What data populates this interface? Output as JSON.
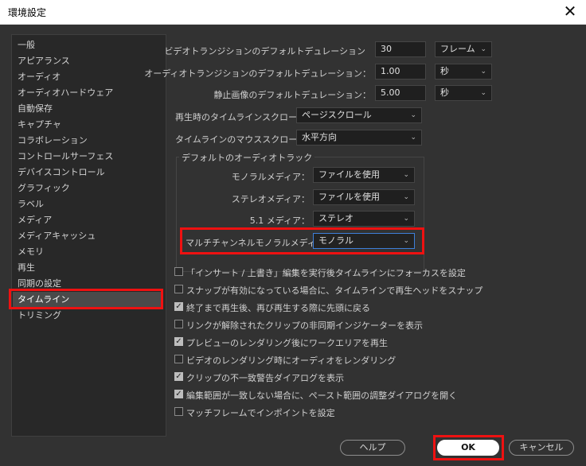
{
  "window": {
    "title": "環境設定",
    "close": "✕"
  },
  "sidebar": {
    "items": [
      {
        "label": "一般"
      },
      {
        "label": "アピアランス"
      },
      {
        "label": "オーディオ"
      },
      {
        "label": "オーディオハードウェア"
      },
      {
        "label": "自動保存"
      },
      {
        "label": "キャプチャ"
      },
      {
        "label": "コラボレーション"
      },
      {
        "label": "コントロールサーフェス"
      },
      {
        "label": "デバイスコントロール"
      },
      {
        "label": "グラフィック"
      },
      {
        "label": "ラベル"
      },
      {
        "label": "メディア"
      },
      {
        "label": "メディアキャッシュ"
      },
      {
        "label": "メモリ"
      },
      {
        "label": "再生"
      },
      {
        "label": "同期の設定"
      },
      {
        "label": "タイムライン"
      },
      {
        "label": "トリミング"
      }
    ],
    "selected": "タイムライン"
  },
  "durations": {
    "video": {
      "label": "ビデオトランジションのデフォルトデュレーション",
      "value": "30",
      "unit": "フレーム"
    },
    "audio": {
      "label": "オーディオトランジションのデフォルトデュレーション：",
      "value": "1.00",
      "unit": "秒"
    },
    "still": {
      "label": "静止画像のデフォルトデュレーション：",
      "value": "5.00",
      "unit": "秒"
    }
  },
  "scroll": {
    "playback": {
      "label": "再生時のタイムラインスクロール",
      "value": "ページスクロール"
    },
    "mouse": {
      "label": "タイムラインのマウススクロール：",
      "value": "水平方向"
    }
  },
  "audio_tracks": {
    "group_title": "デフォルトのオーディオトラック",
    "mono": {
      "label": "モノラルメディア：",
      "value": "ファイルを使用"
    },
    "stereo": {
      "label": "ステレオメディア：",
      "value": "ファイルを使用"
    },
    "five_one": {
      "label": "5.1 メディア：",
      "value": "ステレオ"
    },
    "multichannel": {
      "label": "マルチチャンネルモノラルメディア",
      "value": "モノラル"
    }
  },
  "checkboxes": [
    {
      "label": "「インサート / 上書き」編集を実行後タイムラインにフォーカスを設定",
      "checked": false
    },
    {
      "label": "スナップが有効になっている場合に、タイムラインで再生ヘッドをスナップ",
      "checked": false
    },
    {
      "label": "終了まで再生後、再び再生する際に先頭に戻る",
      "checked": true
    },
    {
      "label": "リンクが解除されたクリップの非同期インジケーターを表示",
      "checked": false
    },
    {
      "label": "プレビューのレンダリング後にワークエリアを再生",
      "checked": true
    },
    {
      "label": "ビデオのレンダリング時にオーディオをレンダリング",
      "checked": false
    },
    {
      "label": "クリップの不一致警告ダイアログを表示",
      "checked": true
    },
    {
      "label": "編集範囲が一致しない場合に、ペースト範囲の調整ダイアログを開く",
      "checked": true
    },
    {
      "label": "マッチフレームでインポイントを設定",
      "checked": false
    }
  ],
  "buttons": {
    "help": "ヘルプ",
    "ok": "OK",
    "cancel": "キャンセル"
  },
  "icons": {
    "chevron": "⌄",
    "check": "✓"
  },
  "colors": {
    "highlight": "#ee1111",
    "dialog_bg": "#323232",
    "selection": "#4a4a4a",
    "focus_blue": "#3d7fd9"
  }
}
